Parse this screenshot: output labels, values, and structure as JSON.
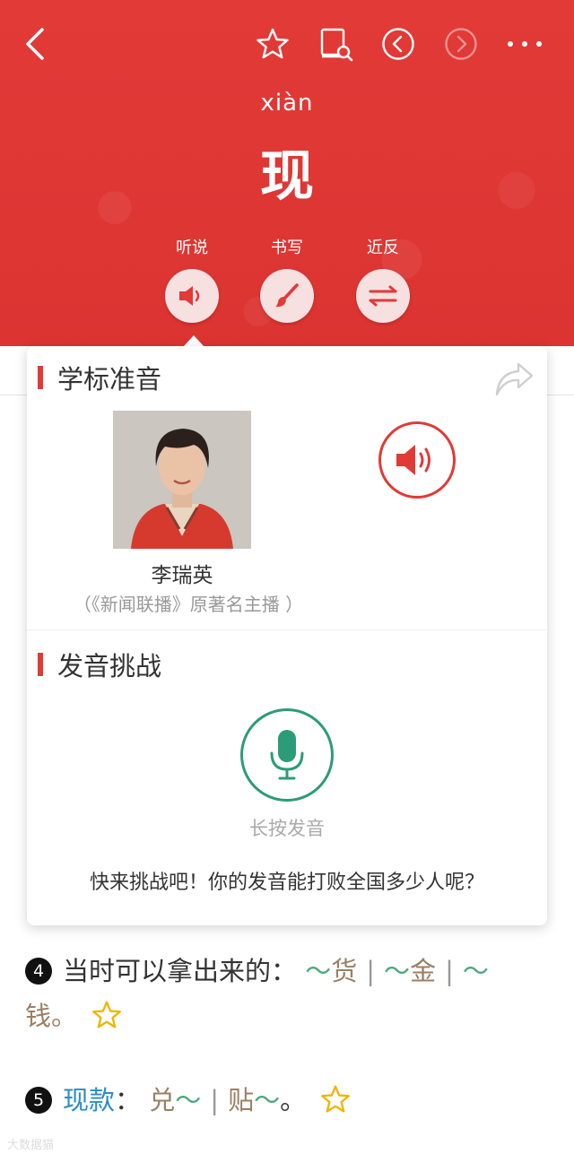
{
  "header": {
    "pinyin": "xiàn",
    "character": "现",
    "tools": [
      {
        "label": "听说",
        "icon": "speaker-icon"
      },
      {
        "label": "书写",
        "icon": "brush-icon"
      },
      {
        "label": "近反",
        "icon": "swap-arrows-icon"
      }
    ]
  },
  "card": {
    "pronunciation_title": "学标准音",
    "anchor_name": "李瑞英",
    "anchor_desc": "（《新闻联播》原著名主播 ）",
    "challenge_title": "发音挑战",
    "mic_hint": "长按发音",
    "challenge_text": "快来挑战吧！你的发音能打败全国多少人呢？"
  },
  "entries": [
    {
      "num": "4",
      "def": "当时可以拿出来的：",
      "ex1_tilde": "～",
      "ex1_char": "货",
      "ex2_tilde": "～",
      "ex2_char": "金",
      "ex3_tilde": "～",
      "ex3_char": "钱。"
    },
    {
      "num": "5",
      "word": "现款",
      "colon": "：",
      "ex1_char": "兑",
      "ex1_tilde": "～",
      "ex2_char": "贴",
      "ex2_tilde": "～",
      "end": "。"
    }
  ],
  "colors": {
    "brand_red": "#e23a37",
    "mic_green": "#2c9c78",
    "link_blue": "#2a8ec8"
  },
  "watermark": "大数据猫"
}
